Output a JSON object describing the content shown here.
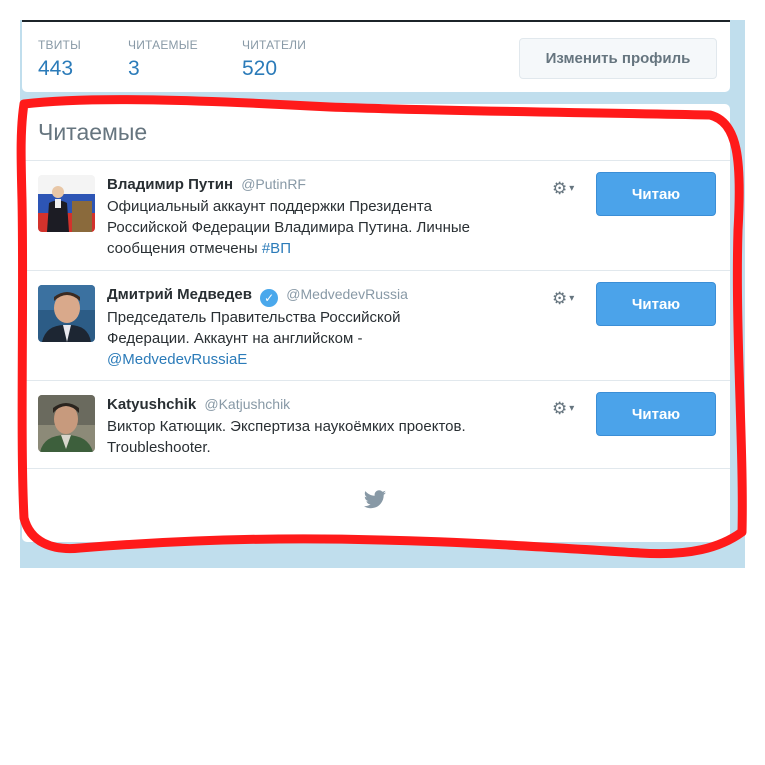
{
  "stats": {
    "tweets": {
      "label": "ТВИТЫ",
      "value": "443"
    },
    "following": {
      "label": "ЧИТАЕМЫЕ",
      "value": "3"
    },
    "followers": {
      "label": "ЧИТАТЕЛИ",
      "value": "520"
    },
    "edit_profile_label": "Изменить профиль"
  },
  "following_card": {
    "title": "Читаемые",
    "follow_label": "Читаю",
    "users": [
      {
        "name": "Владимир Путин",
        "handle": "@PutinRF",
        "verified": false,
        "bio_lines": [
          "Официальный аккаунт поддержки Президента",
          "Российской Федерации Владимира Путина. Личные",
          "сообщения отмечены "
        ],
        "bio_link": "#ВП"
      },
      {
        "name": "Дмитрий Медведев",
        "handle": "@MedvedevRussia",
        "verified": true,
        "bio_lines": [
          "Председатель Правительства Российской",
          "Федерации. Аккаунт на английском -"
        ],
        "bio_link": "@MedvedevRussiaE"
      },
      {
        "name": "Katyushchik",
        "handle": "@Katjushchik",
        "verified": false,
        "bio_lines": [
          "Виктор Катющик. Экспертиза наукоёмких проектов.",
          "Troubleshooter."
        ]
      }
    ]
  },
  "colors": {
    "accent": "#2b7bb9",
    "follow_button": "#4ba3ea",
    "highlight": "#ff0000",
    "page_background": "#c0deed"
  },
  "icons": [
    "gear-icon",
    "chevron-down-icon",
    "verified-badge-icon",
    "twitter-bird-icon"
  ]
}
